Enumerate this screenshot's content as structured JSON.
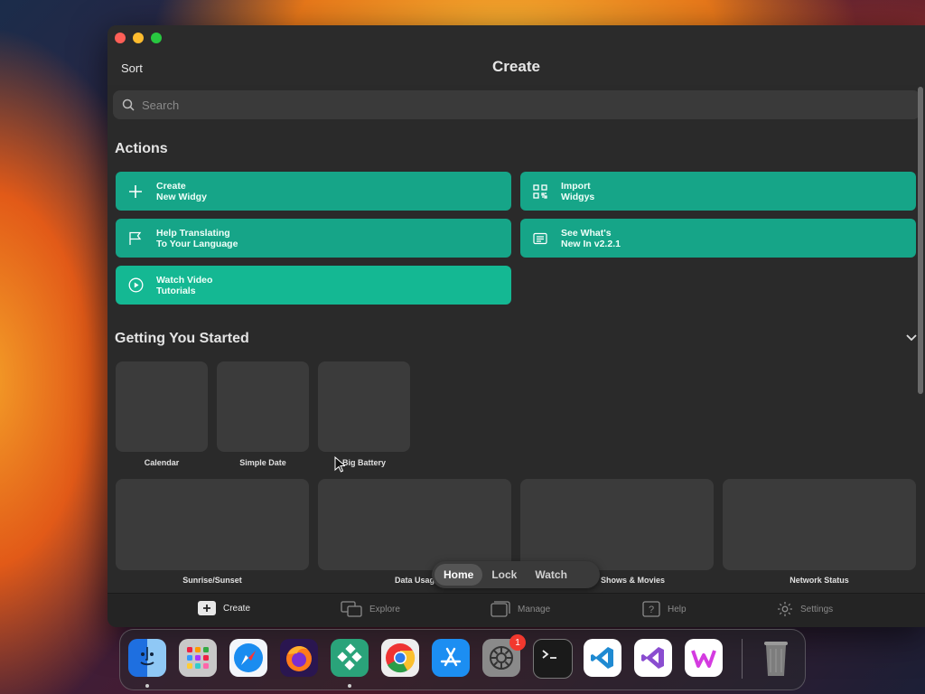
{
  "window": {
    "sort_label": "Sort",
    "title": "Create"
  },
  "search": {
    "placeholder": "Search"
  },
  "actions": {
    "title": "Actions",
    "items": [
      {
        "line1": "Create",
        "line2": "New Widgy",
        "icon": "plus-icon"
      },
      {
        "line1": "Import",
        "line2": "Widgys",
        "icon": "qr-code-icon"
      },
      {
        "line1": "Help Translating",
        "line2": "To Your Language",
        "icon": "flag-icon"
      },
      {
        "line1": "See What's",
        "line2": "New In v2.2.1",
        "icon": "news-icon"
      },
      {
        "line1": "Watch Video",
        "line2": "Tutorials",
        "icon": "play-circle-icon"
      }
    ]
  },
  "getting_started": {
    "title": "Getting You Started",
    "row1": [
      "Calendar",
      "Simple Date",
      "Big Battery"
    ],
    "row2": [
      "Sunrise/Sunset",
      "Data Usag",
      "Shows & Movies",
      "Network Status"
    ]
  },
  "segment": {
    "options": [
      "Home",
      "Lock",
      "Watch"
    ],
    "selected": "Home"
  },
  "tabbar": {
    "items": [
      "Create",
      "Explore",
      "Manage",
      "Help",
      "Settings"
    ],
    "active": "Create"
  },
  "dock": {
    "apps": [
      "Finder",
      "Launchpad",
      "Safari",
      "Firefox",
      "Widgy",
      "Chrome",
      "App Store",
      "System Settings",
      "Terminal",
      "Visual Studio Code",
      "Visual Studio",
      "Widgy Pro",
      "Trash"
    ],
    "settings_badge": "1"
  },
  "colors": {
    "accent": "#16a588",
    "window_bg": "#2b2b2b",
    "tile_bg": "#3b3b3b"
  }
}
